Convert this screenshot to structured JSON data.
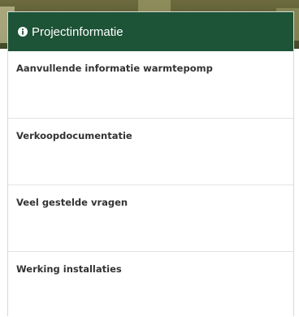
{
  "panel": {
    "header_title": "Projectinformatie",
    "header_icon": "info-circle-icon",
    "header_color": "#1d5336"
  },
  "items": [
    {
      "label": "Aanvullende informatie warmtepomp"
    },
    {
      "label": "Verkoopdocumentatie"
    },
    {
      "label": "Veel gestelde vragen"
    },
    {
      "label": "Werking installaties"
    }
  ]
}
